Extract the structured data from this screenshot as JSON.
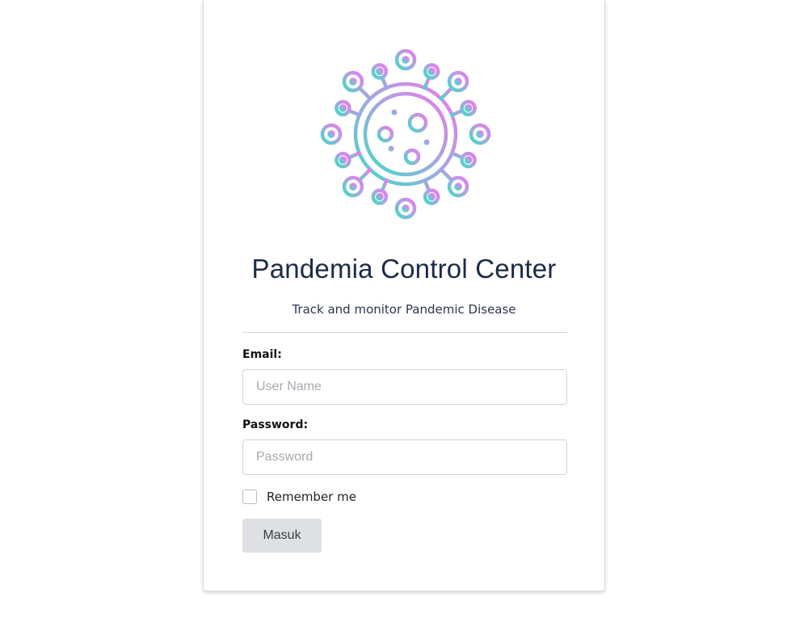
{
  "app": {
    "title": "Pandemia Control Center",
    "subtitle": "Track and monitor Pandemic Disease"
  },
  "logo": {
    "icon": "virus-icon",
    "gradient_start": "#4fd8c8",
    "gradient_end": "#e07cf0"
  },
  "form": {
    "email_label": "Email:",
    "email_placeholder": "User Name",
    "email_value": "",
    "password_label": "Password:",
    "password_placeholder": "Password",
    "password_value": "",
    "remember_label": "Remember me",
    "remember_checked": false,
    "submit_label": "Masuk"
  },
  "colors": {
    "title": "#1b2a47",
    "button_bg": "#dfe0e2"
  }
}
